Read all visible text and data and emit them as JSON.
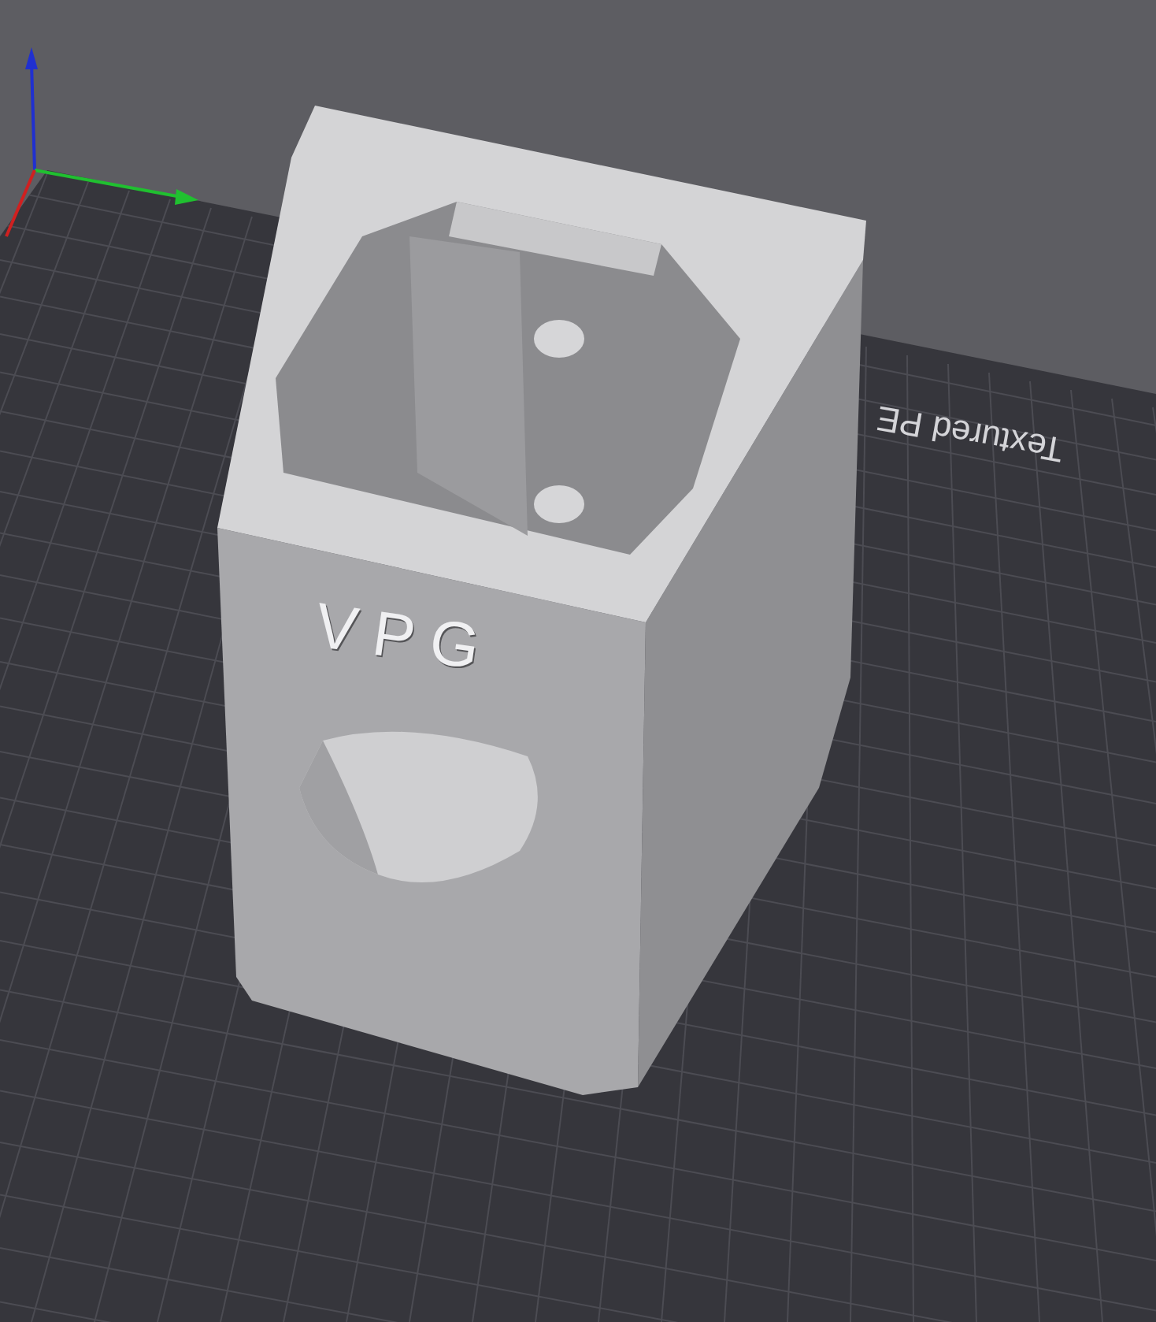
{
  "bed": {
    "label": "Textured PE"
  },
  "model": {
    "emboss": "VPG"
  }
}
